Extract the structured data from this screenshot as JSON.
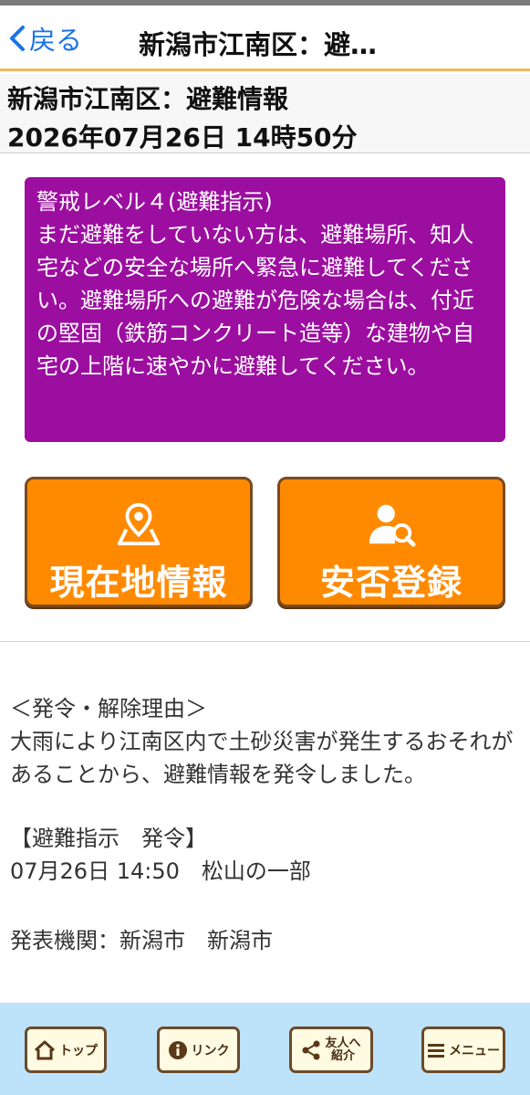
{
  "header": {
    "back_label": "戻る",
    "title": "新潟市江南区：避…"
  },
  "info": {
    "title": "新潟市江南区：避難情報",
    "datetime": "2026年07月26日 14時50分"
  },
  "alert": {
    "level": "警戒レベル４(避難指示)",
    "message": "まだ避難をしていない方は、避難場所、知人宅などの安全な場所へ緊急に避難してください。避難場所への避難が危険な場合は、付近の堅固（鉄筋コンクリート造等）な建物や自宅の上階に速やかに避難してください。",
    "color": "#9c0ea0"
  },
  "buttons": {
    "location_label": "現在地情報",
    "location_icon": "map-pin-icon",
    "safety_label": "安否登録",
    "safety_icon": "user-search-icon",
    "color": "#ff8a00"
  },
  "content": {
    "reason_heading": "＜発令・解除理由＞",
    "reason_text": "大雨により江南区内で土砂災害が発生するおそれがあることから、避難情報を発令しました。",
    "order_heading": "【避難指示　発令】",
    "order_detail": "07月26日 14:50　松山の一部",
    "issuer": "発表機関：新潟市　新潟市"
  },
  "footer": {
    "top_label": "トップ",
    "link_label": "リンク",
    "share_label_line1": "友人へ",
    "share_label_line2": "紹介",
    "menu_label": "メニュー"
  }
}
